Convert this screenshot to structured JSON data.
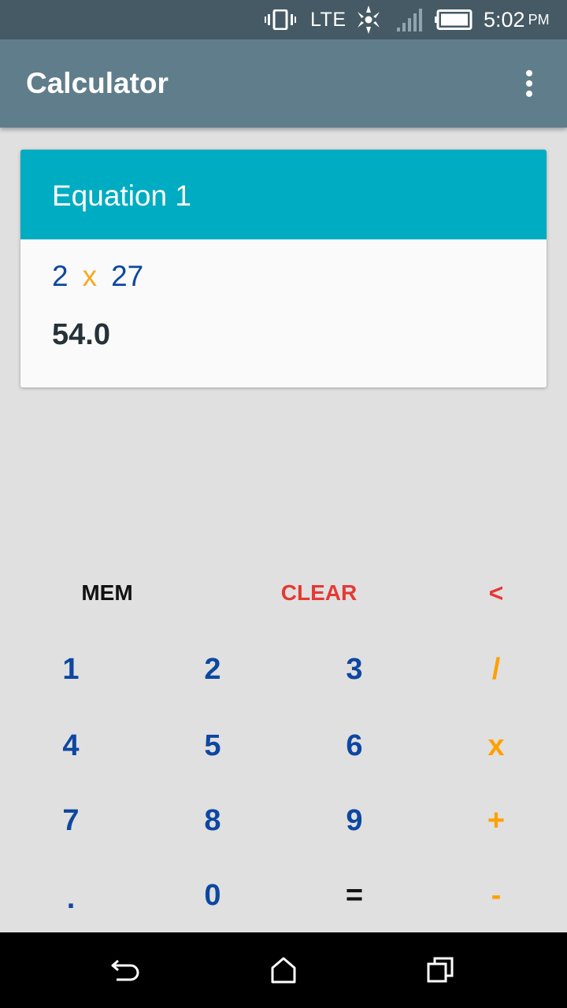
{
  "status_bar": {
    "network": "LTE",
    "time": "5:02",
    "ampm": "PM",
    "icons": [
      "vibrate-icon",
      "data-transfer-icon",
      "signal-icon",
      "battery-icon"
    ]
  },
  "app_bar": {
    "title": "Calculator",
    "menu_icon": "overflow-menu-icon"
  },
  "equation_card": {
    "title": "Equation 1",
    "operand_1": "2",
    "operator": "x",
    "operand_2": "27",
    "result": "54.0"
  },
  "keypad": {
    "function_row": {
      "mem": "MEM",
      "clear": "CLEAR",
      "backspace": "<"
    },
    "row_1": [
      "1",
      "2",
      "3",
      "/"
    ],
    "row_2": [
      "4",
      "5",
      "6",
      "x"
    ],
    "row_3": [
      "7",
      "8",
      "9",
      "+"
    ],
    "row_4": [
      ".",
      "0",
      "=",
      "-"
    ]
  },
  "nav_bar": {
    "icons": [
      "back-icon",
      "home-icon",
      "recents-icon"
    ]
  },
  "colors": {
    "status_bar": "#455a64",
    "app_bar": "#607d8b",
    "card_header": "#00acc1",
    "digit": "#0d47a1",
    "operator": "#ffa000",
    "clear": "#e53935"
  }
}
